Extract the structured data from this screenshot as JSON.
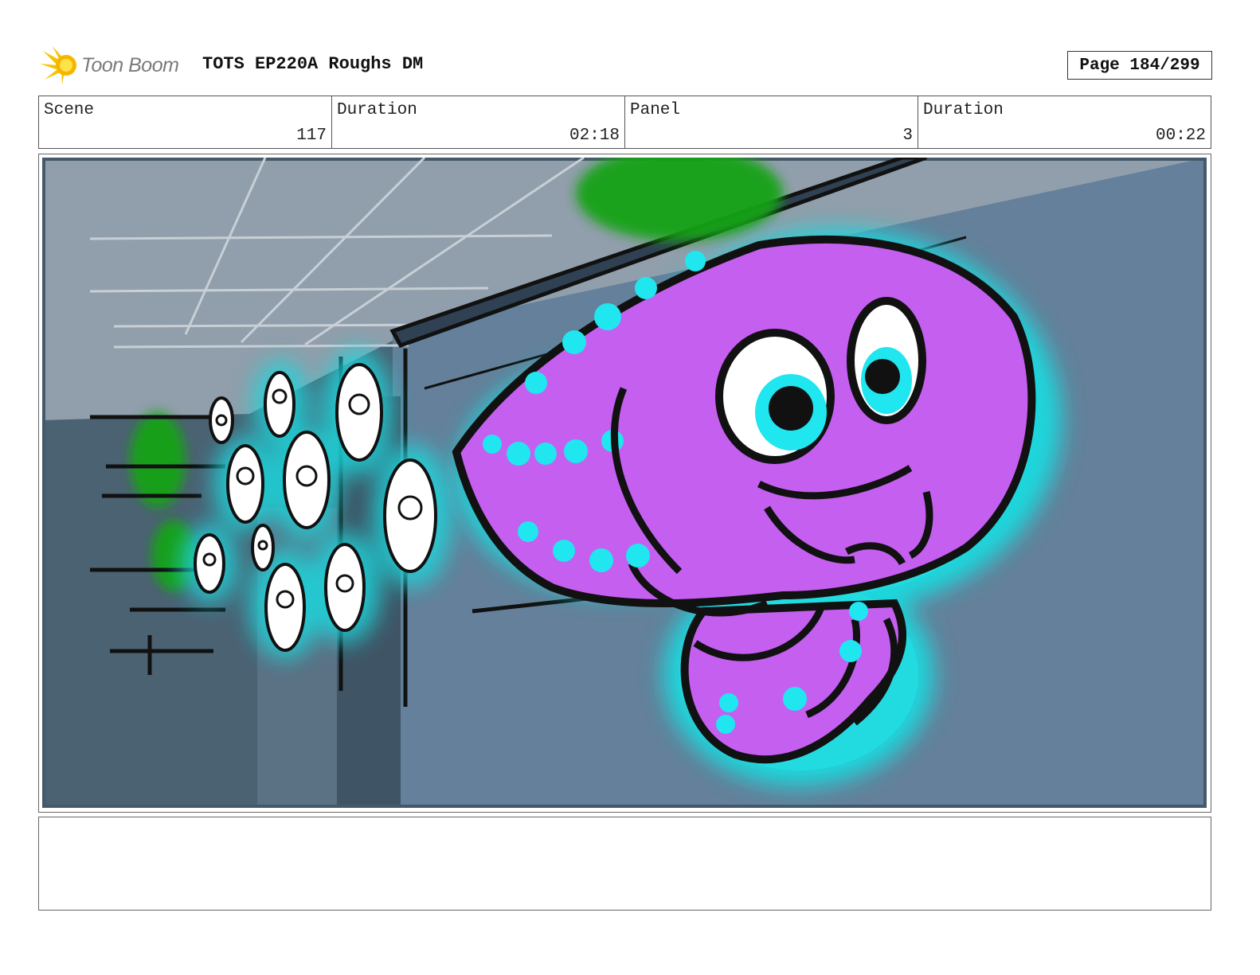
{
  "header": {
    "logo_text": "Toon Boom",
    "title": "TOTS EP220A Roughs DM",
    "page_label": "Page 184/299"
  },
  "info": {
    "scene_label": "Scene",
    "scene_value": "117",
    "scene_duration_label": "Duration",
    "scene_duration_value": "02:18",
    "panel_label": "Panel",
    "panel_value": "3",
    "panel_duration_label": "Duration",
    "panel_duration_value": "00:22"
  },
  "notes": {
    "text": ""
  },
  "colors": {
    "sky": "#909fab",
    "wall": "#63809a",
    "wall_dark": "#425869",
    "squid": "#c55ff0",
    "glow": "#1fd6dc",
    "slime": "#22b41c",
    "border": "#555555"
  },
  "icons": {
    "logo": "toon-boom-sun-icon"
  }
}
